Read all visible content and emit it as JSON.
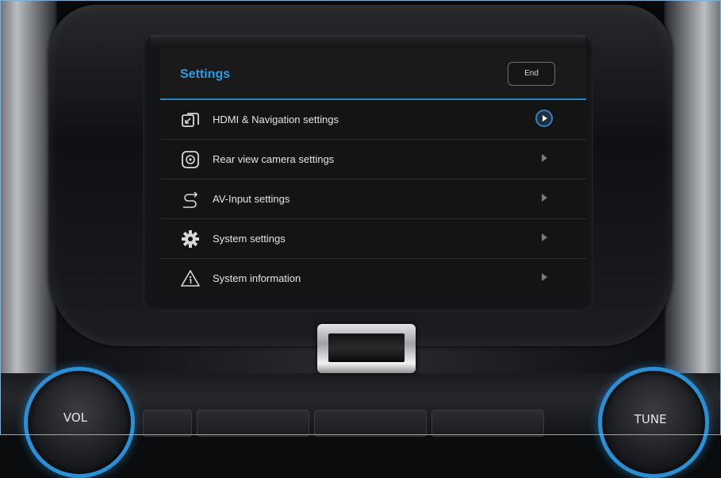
{
  "screen": {
    "title": "Settings",
    "end_label": "End",
    "accent_color": "#2a9be0",
    "menu": [
      {
        "label": "HDMI & Navigation settings",
        "icon": "input-switch-icon",
        "selected": true
      },
      {
        "label": "Rear view camera settings",
        "icon": "camera-icon",
        "selected": false
      },
      {
        "label": "AV-Input settings",
        "icon": "av-input-icon",
        "selected": false
      },
      {
        "label": "System settings",
        "icon": "gear-icon",
        "selected": false
      },
      {
        "label": "System information",
        "icon": "info-triangle-icon",
        "selected": false
      }
    ]
  },
  "hardware": {
    "vol_label": "VOL",
    "tune_label": "TUNE",
    "knob_color": "#2b8fd6"
  }
}
